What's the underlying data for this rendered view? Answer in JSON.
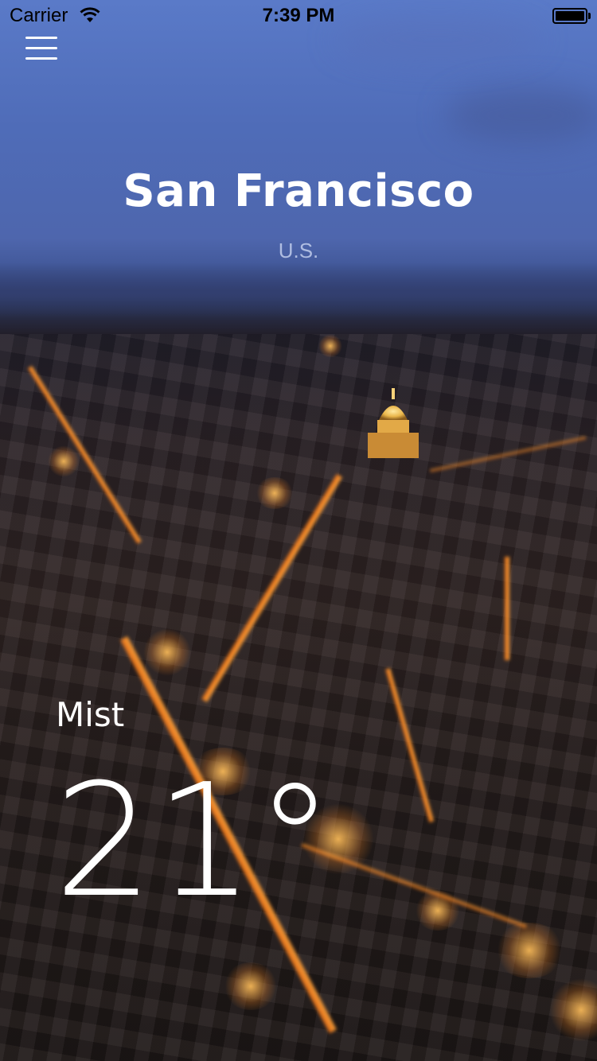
{
  "status_bar": {
    "carrier": "Carrier",
    "time": "7:39 PM"
  },
  "header": {
    "menu_icon": "hamburger-menu-icon"
  },
  "location": {
    "city": "San Francisco",
    "country": "U.S."
  },
  "weather": {
    "condition": "Mist",
    "temperature": "21°"
  },
  "colors": {
    "text": "#ffffff",
    "sky": "#5a7ac8",
    "city_lights": "#ffa53c"
  }
}
